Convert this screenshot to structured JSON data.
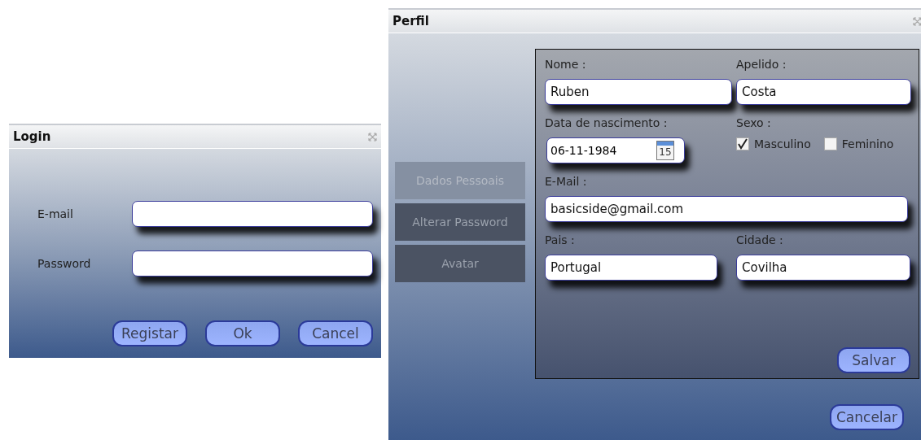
{
  "login": {
    "title": "Login",
    "fields": [
      {
        "label": "E-mail"
      },
      {
        "label": "Password"
      }
    ],
    "buttons": [
      "Registar",
      "Ok",
      "Cancel"
    ]
  },
  "perfil": {
    "title": "Perfil",
    "nav": [
      {
        "label": "Dados Pessoais",
        "selected": true
      },
      {
        "label": "Alterar Password",
        "selected": false
      },
      {
        "label": "Avatar",
        "selected": false
      }
    ],
    "nome": {
      "label": "Nome :",
      "value": "Ruben"
    },
    "apelido": {
      "label": "Apelido :",
      "value": "Costa"
    },
    "nascimento": {
      "label": "Data de nascimento :",
      "value": "06-11-1984",
      "calendar_day": "15"
    },
    "sexo": {
      "label": "Sexo :",
      "options": [
        {
          "label": "Masculino",
          "checked": true
        },
        {
          "label": "Feminino",
          "checked": false
        }
      ]
    },
    "email": {
      "label": "E-Mail :",
      "value": "basicside@gmail.com"
    },
    "pais": {
      "label": "Pais :",
      "value": "Portugal"
    },
    "cidade": {
      "label": "Cidade :",
      "value": "Covilha"
    },
    "save_button": "Salvar",
    "cancel_button": "Cancelar"
  }
}
